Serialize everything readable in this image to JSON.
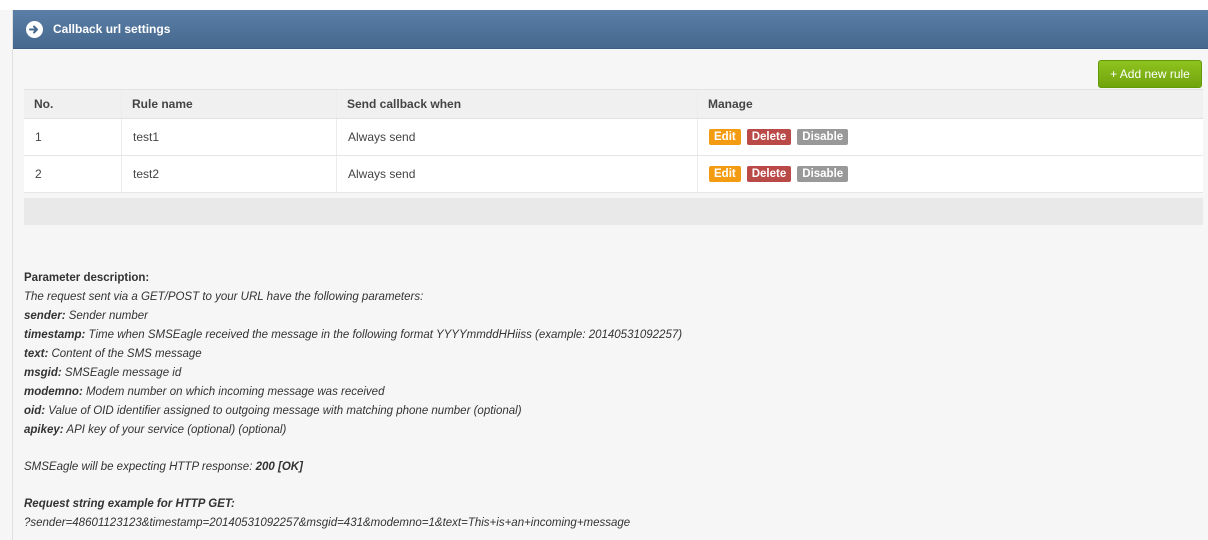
{
  "panel": {
    "title": "Callback url settings",
    "icon": "circle-arrow-right-icon"
  },
  "toolbar": {
    "add_label": "+ Add new rule"
  },
  "table": {
    "headers": [
      "No.",
      "Rule name",
      "Send callback when",
      "Manage"
    ],
    "rows": [
      {
        "no": "1",
        "name": "test1",
        "when": "Always send"
      },
      {
        "no": "2",
        "name": "test2",
        "when": "Always send"
      }
    ],
    "actions": {
      "edit": "Edit",
      "delete": "Delete",
      "disable": "Disable"
    }
  },
  "params": {
    "heading": "Parameter description:",
    "intro": "The request sent via a GET/POST to your URL have the following parameters:",
    "items": [
      {
        "key": "sender:",
        "desc": " Sender number"
      },
      {
        "key": "timestamp:",
        "desc": " Time when SMSEagle received the message in the following format YYYYmmddHHiiss (example: 20140531092257)"
      },
      {
        "key": "text:",
        "desc": " Content of the SMS message"
      },
      {
        "key": "msgid:",
        "desc": " SMSEagle message id"
      },
      {
        "key": "modemno:",
        "desc": " Modem number on which incoming message was received"
      },
      {
        "key": "oid:",
        "desc": " Value of OID identifier assigned to outgoing message with matching phone number (optional)"
      },
      {
        "key": "apikey:",
        "desc": " API key of your service (optional) (optional)"
      }
    ],
    "response_prefix": "SMSEagle will be expecting HTTP response: ",
    "response_value": "200 [OK]",
    "example_heading": "Request string example for HTTP GET:",
    "example": "?sender=48601123123&timestamp=20140531092257&msgid=431&modemno=1&text=This+is+an+incoming+message"
  },
  "colors": {
    "header_bg": "#4f7399",
    "add_button": "#7cb518",
    "edit": "#f39c12",
    "delete": "#b94a48",
    "disable": "#999999"
  }
}
